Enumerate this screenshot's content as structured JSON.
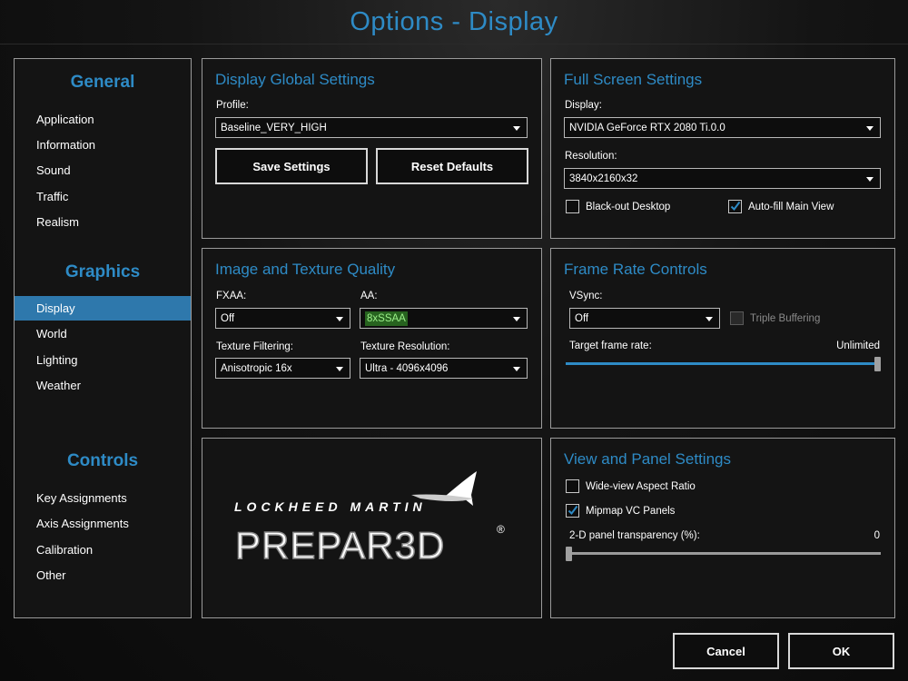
{
  "window": {
    "title": "Options - Display"
  },
  "sidebar": {
    "sections": [
      {
        "heading": "General",
        "items": [
          "Application",
          "Information",
          "Sound",
          "Traffic",
          "Realism"
        ]
      },
      {
        "heading": "Graphics",
        "items": [
          "Display",
          "World",
          "Lighting",
          "Weather"
        ]
      },
      {
        "heading": "Controls",
        "items": [
          "Key Assignments",
          "Axis Assignments",
          "Calibration",
          "Other"
        ]
      }
    ],
    "active_item": "Display"
  },
  "global": {
    "title": "Display Global Settings",
    "profile_label": "Profile:",
    "profile_value": "Baseline_VERY_HIGH",
    "save_label": "Save Settings",
    "reset_label": "Reset Defaults"
  },
  "fullscreen": {
    "title": "Full Screen Settings",
    "display_label": "Display:",
    "display_value": "NVIDIA GeForce RTX 2080 Ti.0.0",
    "resolution_label": "Resolution:",
    "resolution_value": "3840x2160x32",
    "blackout_label": "Black-out Desktop",
    "blackout_checked": false,
    "autofill_label": "Auto-fill Main View",
    "autofill_checked": true
  },
  "image_quality": {
    "title": "Image and Texture Quality",
    "fxaa_label": "FXAA:",
    "fxaa_value": "Off",
    "aa_label": "AA:",
    "aa_value": "8xSSAA",
    "texfilter_label": "Texture Filtering:",
    "texfilter_value": "Anisotropic 16x",
    "texres_label": "Texture Resolution:",
    "texres_value": "Ultra - 4096x4096"
  },
  "frame_rate": {
    "title": "Frame Rate Controls",
    "vsync_label": "VSync:",
    "vsync_value": "Off",
    "triple_label": "Triple Buffering",
    "triple_checked": false,
    "target_label": "Target frame rate:",
    "target_value": "Unlimited",
    "target_fraction": 1.0
  },
  "logo": {
    "company": "LOCKHEED MARTIN",
    "product": "PREPAR3D",
    "registered": "®"
  },
  "view_panel": {
    "title": "View and Panel Settings",
    "wideview_label": "Wide-view Aspect Ratio",
    "wideview_checked": false,
    "mipmap_label": "Mipmap VC Panels",
    "mipmap_checked": true,
    "transparency_label": "2-D panel transparency (%):",
    "transparency_value": "0",
    "transparency_fraction": 0.0
  },
  "footer": {
    "cancel_label": "Cancel",
    "ok_label": "OK"
  },
  "colors": {
    "accent": "#2e8bc6",
    "active_item_bg": "#2e78ac",
    "aa_highlight": "#27631f"
  }
}
